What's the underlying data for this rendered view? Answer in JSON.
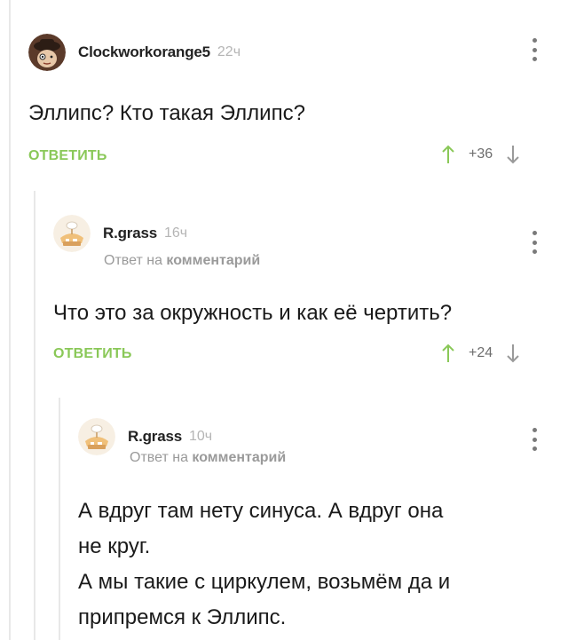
{
  "reply_label": "ОТВЕТИТЬ",
  "reply_to_prefix": "Ответ на",
  "reply_to_target": "комментарий",
  "colors": {
    "reply": "#8ac858",
    "upvote": "#8ac858",
    "downvote": "#9a9a9a"
  },
  "comments": [
    {
      "author": "Clockworkorange5",
      "time": "22ч",
      "lines": [
        "Эллипс? Кто такая Эллипс?"
      ],
      "rating": "+36"
    },
    {
      "author": "R.grass",
      "time": "16ч",
      "lines": [
        "Что это за окружность и как её чертить?"
      ],
      "rating": "+24"
    },
    {
      "author": "R.grass",
      "time": "10ч",
      "lines": [
        "А вдруг там нету синуса. А вдруг она",
        "не круг.",
        "А мы такие с циркулем, возьмём да и",
        "припремся к Эллипс."
      ]
    }
  ]
}
